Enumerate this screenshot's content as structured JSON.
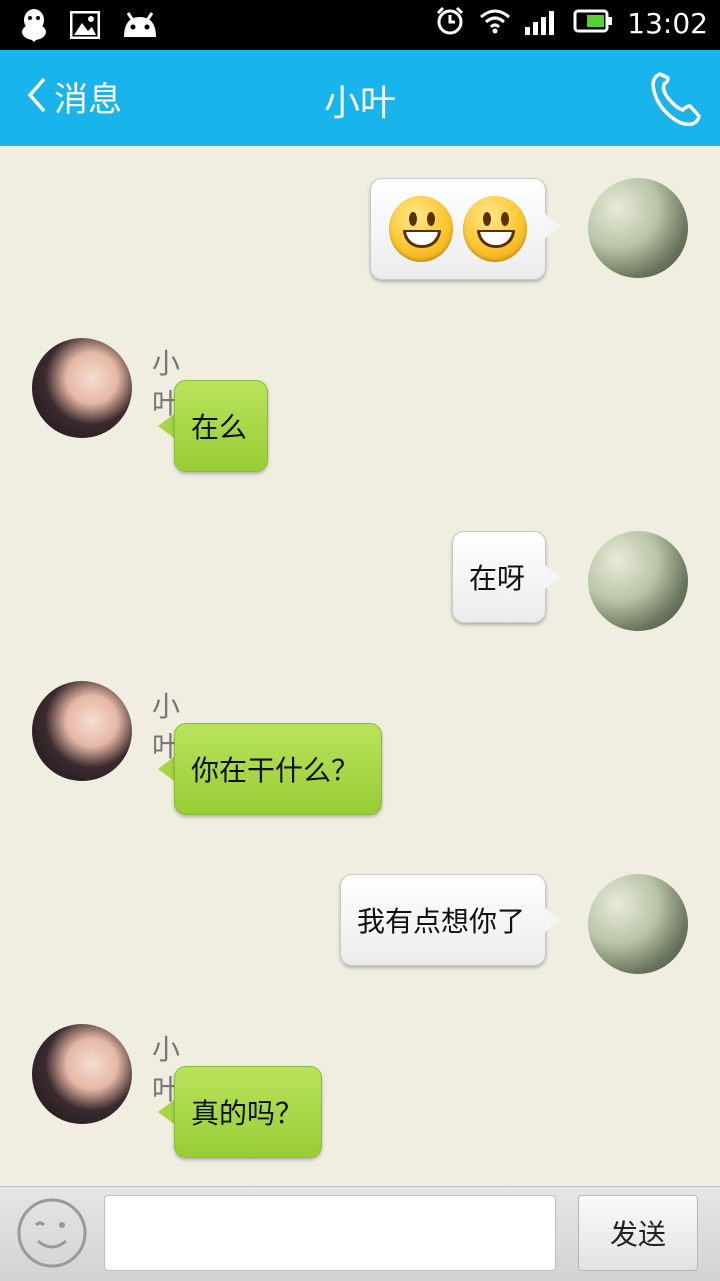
{
  "status_bar": {
    "time": "13:02",
    "left_icons": [
      "qq-penguin-icon",
      "gallery-icon",
      "android-icon"
    ],
    "right_icons": [
      "alarm-icon",
      "wifi-icon",
      "signal-icon",
      "battery-icon"
    ]
  },
  "nav": {
    "back_label": "消息",
    "title": "小叶",
    "call_icon": "phone-icon"
  },
  "messages": [
    {
      "side": "me",
      "type": "emoji",
      "emojis": [
        "smiley",
        "smiley"
      ]
    },
    {
      "side": "her",
      "sender": "小叶",
      "text": "在么"
    },
    {
      "side": "me",
      "text": "在呀"
    },
    {
      "side": "her",
      "sender": "小叶",
      "text": "你在干什么？"
    },
    {
      "side": "me",
      "text": "我有点想你了"
    },
    {
      "side": "her",
      "sender": "小叶",
      "text": "真的吗？"
    }
  ],
  "input_bar": {
    "emoji_button_icon": "wink-face-icon",
    "input_value": "",
    "send_label": "发送"
  },
  "colors": {
    "nav_bg": "#19b4ec",
    "chat_bg": "#efeee1",
    "her_bubble": "#a6d644",
    "me_bubble": "#f5f5f5"
  }
}
